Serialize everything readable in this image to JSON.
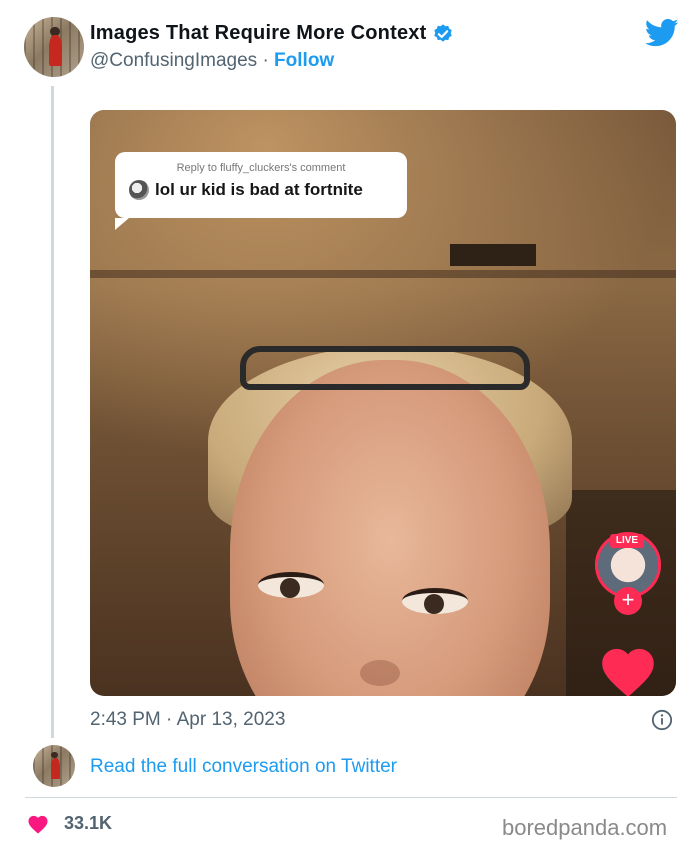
{
  "author": {
    "name": "Images That Require More Context",
    "handle": "@ConfusingImages",
    "separator": "·",
    "follow_label": "Follow"
  },
  "media": {
    "reply_header": "Reply to fluffy_cluckers's comment",
    "reply_text": "lol ur kid is bad at fortnite",
    "live_label": "LIVE",
    "plus_label": "+"
  },
  "tweet": {
    "timestamp": "2:43 PM · Apr 13, 2023",
    "read_more": "Read the full conversation on Twitter",
    "likes": "33.1K"
  },
  "footer": {
    "watermark": "boredpanda.com"
  },
  "colors": {
    "twitter_blue": "#1d9bf0",
    "like_red": "#f91880",
    "tiktok_red": "#fe2c55",
    "muted_text": "#536471"
  }
}
